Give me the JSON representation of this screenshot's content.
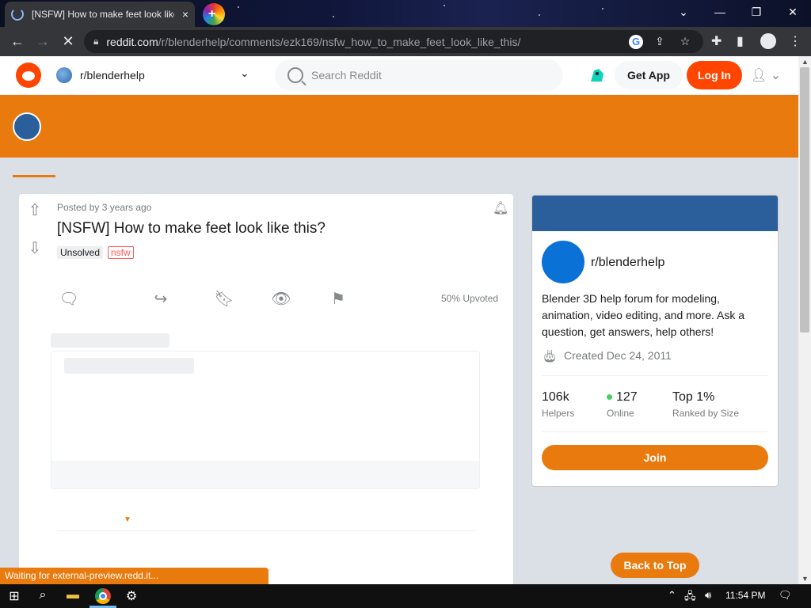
{
  "browser": {
    "tab_title": "[NSFW] How to make feet look like this?",
    "tab_close": "×",
    "url_host": "reddit.com",
    "url_path": "/r/blenderhelp/comments/ezk169/nsfw_how_to_make_feet_look_like_this/",
    "status_text": "Waiting for external-preview.redd.it..."
  },
  "header": {
    "subreddit": "r/blenderhelp",
    "search_placeholder": "Search Reddit",
    "get_app": "Get App",
    "login": "Log In"
  },
  "post": {
    "posted_by": "Posted by 3 years ago",
    "title": "[NSFW] How to make feet look like this?",
    "flair": "Unsolved",
    "nsfw_tag": "nsfw",
    "upvoted": "50% Upvoted"
  },
  "sidebar": {
    "name": "r/blenderhelp",
    "description": "Blender 3D help forum for modeling, animation, video editing, and more. Ask a question, get answers, help others!",
    "created": "Created Dec 24, 2011",
    "stats": [
      {
        "value": "106k",
        "label": "Helpers"
      },
      {
        "value": "127",
        "label": "Online"
      },
      {
        "value": "Top 1%",
        "label": "Ranked by Size"
      }
    ],
    "join": "Join"
  },
  "back_to_top": "Back to Top",
  "taskbar": {
    "time": "11:54 PM"
  },
  "colors": {
    "accent": "#e97a0e",
    "reddit_orange": "#ff4500",
    "sub_blue": "#2a5f9c"
  }
}
